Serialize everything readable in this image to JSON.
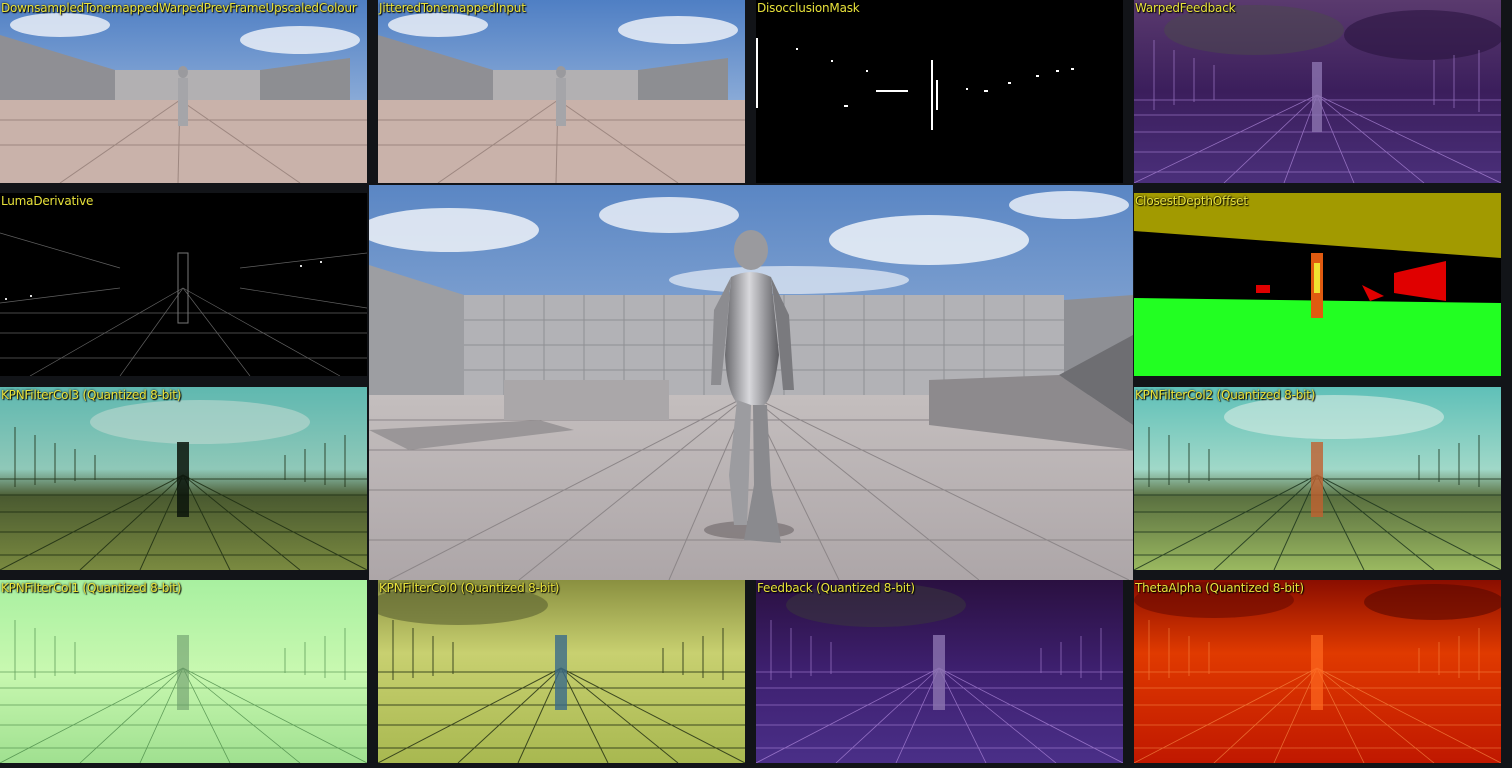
{
  "viewport": {
    "main_view": "main-viewport",
    "label_color": "#e8e23a",
    "panels": [
      {
        "id": "p0",
        "label": "DownsampledTonemappedWarpedPrevFrameUpscaledColour",
        "style": "scene"
      },
      {
        "id": "p1",
        "label": "JitteredTonemappedInput",
        "style": "scene"
      },
      {
        "id": "p2",
        "label": "DisocclusionMask",
        "style": "mask"
      },
      {
        "id": "p3",
        "label": "WarpedFeedback",
        "style": "purple"
      },
      {
        "id": "p4",
        "label": "LumaDerivative",
        "style": "luma"
      },
      {
        "id": "p5",
        "label": "ClosestDepthOffset",
        "style": "depth"
      },
      {
        "id": "p6",
        "label": "KPNFilterCol3 (Quantized 8-bit)",
        "style": "teal"
      },
      {
        "id": "p7",
        "label": "KPNFilterCol2 (Quantized 8-bit)",
        "style": "teal"
      },
      {
        "id": "p8",
        "label": "KPNFilterCol1 (Quantized 8-bit)",
        "style": "lime"
      },
      {
        "id": "p9",
        "label": "KPNFilterCol0 (Quantized 8-bit)",
        "style": "olive"
      },
      {
        "id": "p10",
        "label": "Feedback (Quantized 8-bit)",
        "style": "purple"
      },
      {
        "id": "p11",
        "label": "ThetaAlpha (Quantized 8-bit)",
        "style": "red"
      }
    ]
  },
  "colors": {
    "sky_top": "#4f7fc4",
    "sky_bottom": "#b8cce4",
    "floor": "#b9a9a2",
    "wall": "#a9a9ad",
    "purple": "#3a1a5e",
    "red": "#c41e00",
    "teal": "#3fb0a8",
    "lime": "#aef0a0",
    "depth_green": "#22ff22",
    "depth_olive": "#a09a00"
  }
}
